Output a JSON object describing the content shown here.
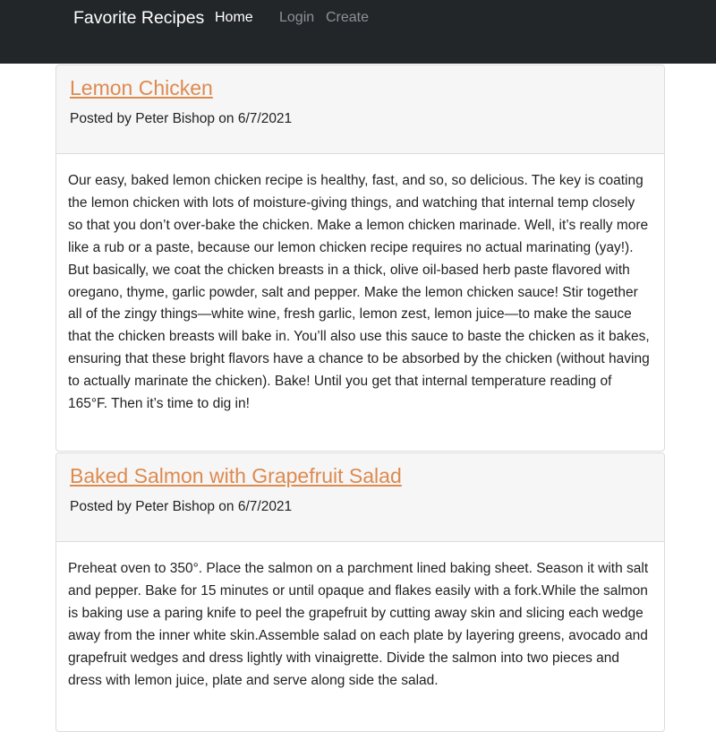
{
  "navbar": {
    "brand": "Favorite Recipes",
    "links": [
      {
        "label": "Home"
      },
      {
        "label": "Login"
      },
      {
        "label": "Create"
      }
    ]
  },
  "recipes": [
    {
      "title": "Lemon Chicken",
      "posted": "Posted by Peter Bishop on 6/7/2021",
      "body": "Our easy, baked lemon chicken recipe is healthy, fast, and so, so delicious. The key is coating the lemon chicken with lots of moisture-giving things, and watching that internal temp closely so that you don’t over-bake the chicken. Make a lemon chicken marinade. Well, it’s really more like a rub or a paste, because our lemon chicken recipe requires no actual marinating (yay!). But basically, we coat the chicken breasts in a thick, olive oil-based herb paste flavored with oregano, thyme, garlic powder, salt and pepper. Make the lemon chicken sauce! Stir together all of the zingy things—white wine, fresh garlic, lemon zest, lemon juice—to make the sauce that the chicken breasts will bake in. You’ll also use this sauce to baste the chicken as it bakes, ensuring that these bright flavors have a chance to be absorbed by the chicken (without having to actually marinate the chicken). Bake! Until you get that internal temperature reading of 165°F. Then it’s time to dig in!"
    },
    {
      "title": "Baked Salmon with Grapefruit Salad",
      "posted": "Posted by Peter Bishop on 6/7/2021",
      "body": "Preheat oven to 350°. Place the salmon on a parchment lined baking sheet. Season it with salt and pepper. Bake for 15 minutes or until opaque and flakes easily with a fork.While the salmon is baking use a paring knife to peel the grapefruit by cutting away skin and slicing each wedge away from the inner white skin.Assemble salad on each plate by layering greens, avocado and grapefruit wedges and dress lightly with vinaigrette. Divide the salmon into two pieces and dress with lemon juice, plate and serve along side the salad."
    }
  ]
}
